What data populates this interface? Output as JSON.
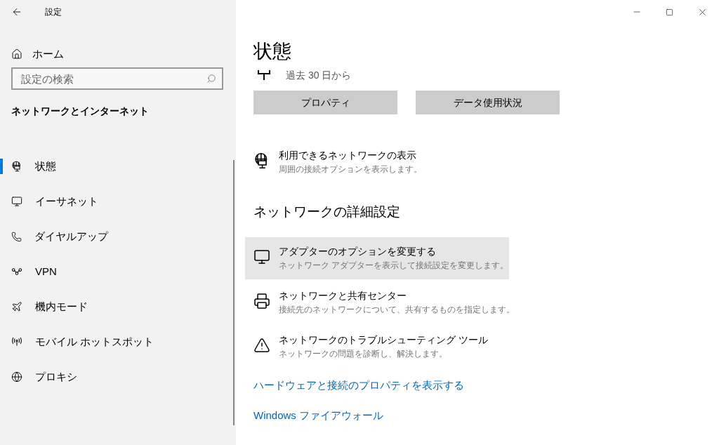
{
  "window": {
    "title": "設定"
  },
  "sidebar": {
    "home": "ホーム",
    "search": {
      "placeholder": "設定の検索"
    },
    "heading": "ネットワークとインターネット",
    "items": [
      {
        "label": "状態",
        "selected": true
      },
      {
        "label": "イーサネット",
        "selected": false
      },
      {
        "label": "ダイヤルアップ",
        "selected": false
      },
      {
        "label": "VPN",
        "selected": false
      },
      {
        "label": "機内モード",
        "selected": false
      },
      {
        "label": "モバイル ホットスポット",
        "selected": false
      },
      {
        "label": "プロキシ",
        "selected": false
      }
    ]
  },
  "main": {
    "title": "状態",
    "usage_note": "過去 30 日から",
    "buttons": [
      "プロパティ",
      "データ使用状況"
    ],
    "network_link": {
      "title": "利用できるネットワークの表示",
      "description": "周囲の接続オプションを表示します。"
    },
    "advanced_heading": "ネットワークの詳細設定",
    "advanced_items": [
      {
        "title": "アダプターのオプションを変更する",
        "description": "ネットワーク アダプターを表示して接続設定を変更します。",
        "selected": true
      },
      {
        "title": "ネットワークと共有センター",
        "description": "接続先のネットワークについて、共有するものを指定します。",
        "selected": false
      },
      {
        "title": "ネットワークのトラブルシューティング ツール",
        "description": "ネットワークの問題を診断し、解決します。",
        "selected": false
      }
    ],
    "links": [
      "ハードウェアと接続のプロパティを表示する",
      "Windows ファイアウォール"
    ]
  }
}
